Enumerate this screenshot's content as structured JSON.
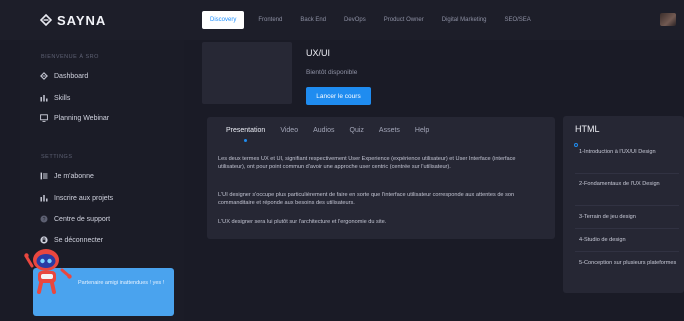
{
  "brand": {
    "name": "SAYNA"
  },
  "nav": {
    "tabs": [
      "Discovery",
      "Frontend",
      "Back End",
      "DevOps",
      "Product Owner",
      "Digital Marketing",
      "SEO/SEA"
    ],
    "active_index": 0
  },
  "sidebar": {
    "section1_title": "BIENVENUE À SRO",
    "items1": [
      {
        "label": "Dashboard",
        "icon": "sayna-logo-icon"
      },
      {
        "label": "Skills",
        "icon": "bar-chart-icon"
      },
      {
        "label": "Planning Webinar",
        "icon": "monitor-icon"
      }
    ],
    "section2_title": "SETTINGS",
    "items2": [
      {
        "label": "Je m'abonne",
        "icon": "list-icon"
      },
      {
        "label": "Inscrire aux projets",
        "icon": "bar-chart-icon"
      },
      {
        "label": "Centre de support",
        "icon": "help-circle-icon"
      },
      {
        "label": "Se déconnecter",
        "icon": "lock-icon"
      }
    ],
    "promo_text": "Partenaire amigi inattendues ! yes !"
  },
  "course": {
    "title": "UX/UI",
    "subtitle": "Bientôt disponible",
    "launch_label": "Lancer le cours"
  },
  "content": {
    "tabs": [
      "Presentation",
      "Video",
      "Audios",
      "Quiz",
      "Assets",
      "Help"
    ],
    "active_tab": 0,
    "paragraphs": [
      "Les deux termes UX et UI, signifiant respectivement User Experience (expérience utilisateur) et User Interface (interface utilisateur), ont pour point commun d'avoir une approche user centric (centrée sur l'utilisateur).",
      "L'UI designer s'occupe plus particulièrement de faire en sorte que l'interface utilisateur corresponde aux attentes de son commanditaire et réponde aux besoins des utilisateurs.",
      "L'UX designer sera lui plutôt sur l'architecture et l'ergonomie du site."
    ]
  },
  "panel": {
    "title": "HTML",
    "lessons": [
      "1-Introduction à l'UX/UI Design",
      "2-Fondamentaux de l'UX Design",
      "3-Terrain de jeu design",
      "4-Studio de design",
      "5-Conception sur plusieurs plateformes"
    ]
  },
  "colors": {
    "accent": "#1f8cf0",
    "background": "#1a1b26",
    "card": "#262734",
    "promo": "#4aa3ee"
  }
}
